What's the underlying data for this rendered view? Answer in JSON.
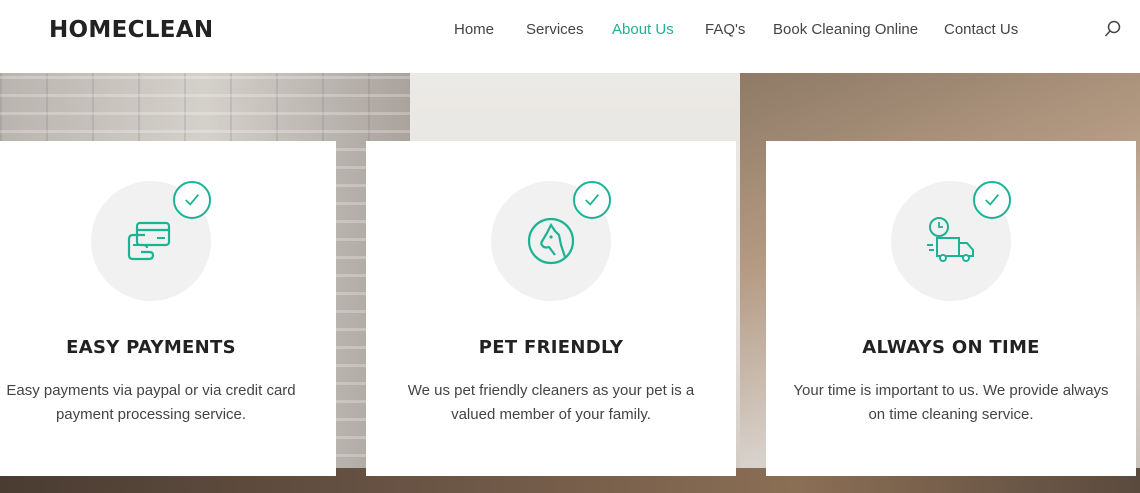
{
  "header": {
    "logo": "HOMECLEAN",
    "nav": [
      {
        "label": "Home",
        "active": false
      },
      {
        "label": "Services",
        "active": false
      },
      {
        "label": "About Us",
        "active": true
      },
      {
        "label": "FAQ's",
        "active": false
      },
      {
        "label": "Book Cleaning Online",
        "active": false
      },
      {
        "label": "Contact Us",
        "active": false
      }
    ],
    "search_icon": "search-icon"
  },
  "accent_color": "#1ab394",
  "features": [
    {
      "icon": "credit-card-icon",
      "title": "EASY PAYMENTS",
      "text_line1": "Easy payments via paypal or via credit card",
      "text_line2": "payment processing service."
    },
    {
      "icon": "pet-dog-icon",
      "title": "PET FRIENDLY",
      "text_line1": "We us pet friendly cleaners as your pet is a",
      "text_line2": "valued member of your family."
    },
    {
      "icon": "delivery-truck-clock-icon",
      "title": "ALWAYS ON TIME",
      "text_line1": "Your time is important to us. We provide always",
      "text_line2": "on time cleaning service."
    }
  ]
}
